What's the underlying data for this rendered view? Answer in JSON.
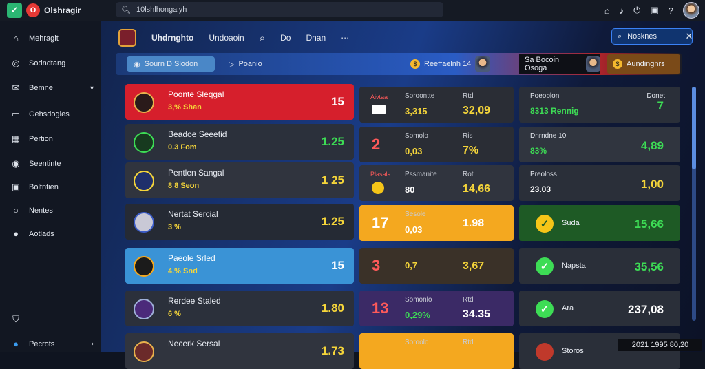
{
  "app": {
    "name": "Olshragir"
  },
  "search": {
    "query": "10lshlhongaiyh"
  },
  "sidebar": {
    "items": [
      {
        "label": "Mehragit",
        "icon": "home-icon"
      },
      {
        "label": "Sodndtang",
        "icon": "globe-icon"
      },
      {
        "label": "Bemne",
        "icon": "mail-icon"
      },
      {
        "label": "Gehsdogies",
        "icon": "folder-icon"
      },
      {
        "label": "Pertion",
        "icon": "grid-icon"
      },
      {
        "label": "Seentinte",
        "icon": "target-icon"
      },
      {
        "label": "Boltntien",
        "icon": "bookmark-icon"
      },
      {
        "label": "Nentes",
        "icon": "clock-icon"
      },
      {
        "label": "Aotlads",
        "icon": "info-icon"
      }
    ],
    "footer": {
      "label": "Pecrots",
      "icon": "settings-icon"
    }
  },
  "header": {
    "title": "Uhdrnghto",
    "link": "Undoaoin",
    "item_a": "Do",
    "item_b": "Dnan",
    "marker_label": "Nosknes"
  },
  "tabs": {
    "active": "Sourn D Slodon",
    "second": "Poanio",
    "promo": "Reeffaelnh 14",
    "group": "Sa Bocoin Osoga",
    "auto": "Aundingnrs"
  },
  "rows": [
    {
      "name": "Poonte Sleqgal",
      "sub": "3,% Shan",
      "odd": "15",
      "color": "#d61f2c"
    },
    {
      "name": "Beadoe Seeetid",
      "sub": "0.3 Fom",
      "odd": "1.25",
      "color": "#2b303b"
    },
    {
      "name": "Pentlen Sangal",
      "sub": "8 8 Seon",
      "odd": "1 25",
      "color": "#30343e"
    },
    {
      "name": "Nertat Sercial",
      "sub": "3 %",
      "odd": "1.25",
      "color": "#252a34"
    },
    {
      "name": "Paeole Srled",
      "sub": "4.% Snd",
      "odd": "15",
      "color": "#3a93d6"
    },
    {
      "name": "Rerdee Staled",
      "sub": "6 %",
      "odd": "1.80",
      "color": "#2b303b"
    },
    {
      "name": "Necerk Sersal",
      "sub": "",
      "odd": "1.73",
      "color": "#30343e"
    }
  ],
  "mid": [
    {
      "num": "",
      "head1": "Soroontte",
      "val1": "3,315",
      "head2": "Rtd",
      "val2": "32,09",
      "label": "Aivtaa",
      "color": "#2a2d35"
    },
    {
      "num": "2",
      "head1": "Somolo",
      "val1": "0,03",
      "head2": "Ris",
      "val2": "7%",
      "color": "#2a2d35"
    },
    {
      "num": "",
      "head1": "Pssmanite",
      "val1": "80",
      "head2": "Rot",
      "val2": "14,66",
      "label": "Plasala",
      "color": "#30343e"
    },
    {
      "num": "17",
      "head1": "Sesole",
      "val1": "0,03",
      "head2": "",
      "val2": "1.98",
      "color": "#f4a81f"
    },
    {
      "num": "3",
      "head1": "",
      "val1": "0,7",
      "head2": "",
      "val2": "3,67",
      "color": "#3a3128"
    },
    {
      "num": "13",
      "head1": "Somonlo",
      "val1": "0,29%",
      "head2": "Rtd",
      "val2": "34.35",
      "color": "#3b2a66"
    },
    {
      "num": "",
      "head1": "Soroolo",
      "val1": "",
      "head2": "Rtd",
      "val2": "",
      "color": "#f4a81f"
    }
  ],
  "right": [
    {
      "head": "Poeoblon",
      "val": "8313 Rennig",
      "headr": "Donet",
      "big": "7",
      "color": "#2a2f39"
    },
    {
      "head": "Dnrndne 10",
      "val": "83%",
      "big": "4,89",
      "color": "#30353f"
    },
    {
      "head": "Preoloss",
      "val": "23.03",
      "big": "1,00",
      "color": "#2a2f39"
    },
    {
      "label": "Suda",
      "big": "15,66",
      "color": "#1e5a25"
    },
    {
      "label": "Napsta",
      "big": "35,56",
      "color": "#2a2f39"
    },
    {
      "label": "Ara",
      "big": "237,08",
      "color": "#2a2f39"
    },
    {
      "label": "Storos",
      "big": "",
      "color": "#2a2f39"
    }
  ],
  "ticker": "2021 1995 80,20"
}
